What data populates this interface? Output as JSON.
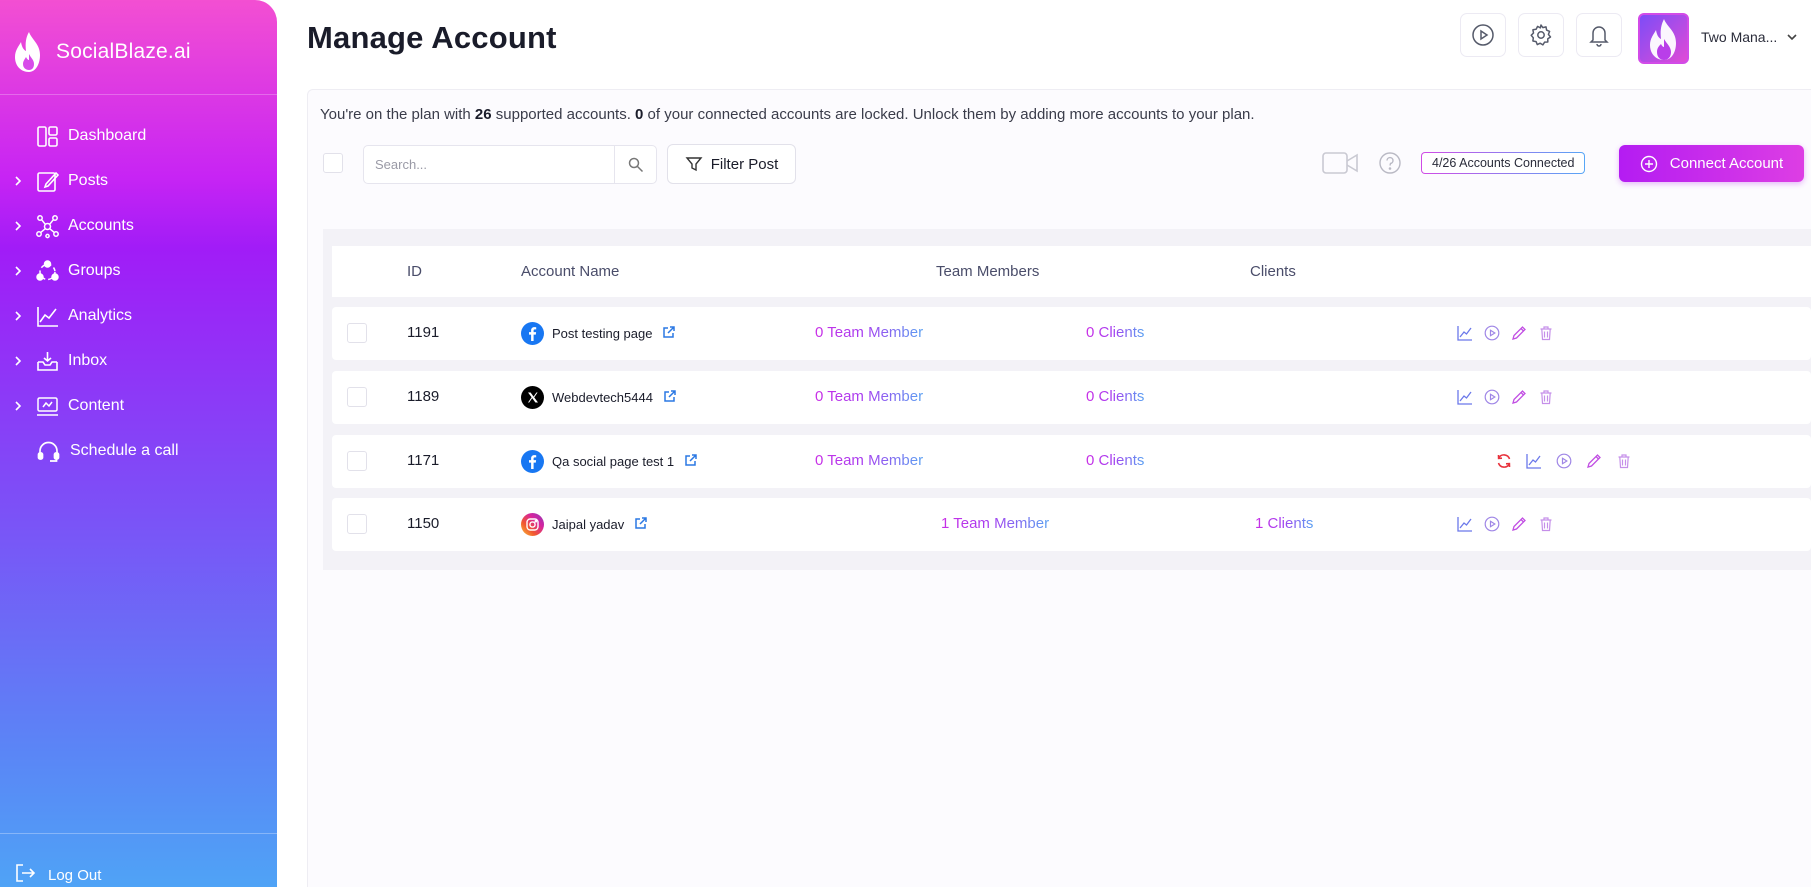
{
  "brand": {
    "name": "SocialBlaze.ai"
  },
  "sidebar": {
    "items": [
      {
        "label": "Dashboard",
        "icon": "dashboard-icon"
      },
      {
        "label": "Posts",
        "icon": "edit-icon"
      },
      {
        "label": "Accounts",
        "icon": "network-icon"
      },
      {
        "label": "Groups",
        "icon": "groups-icon"
      },
      {
        "label": "Analytics",
        "icon": "analytics-icon"
      },
      {
        "label": "Inbox",
        "icon": "inbox-icon"
      },
      {
        "label": "Content",
        "icon": "content-icon"
      },
      {
        "label": "Schedule a call",
        "icon": "headset-icon"
      }
    ],
    "logout": "Log Out"
  },
  "header": {
    "title": "Manage Account",
    "user_name": "Two Mana..."
  },
  "notice": {
    "prefix": "You're on the plan with ",
    "supported": "26",
    "middle": " supported accounts. ",
    "locked": "0",
    "suffix": " of your connected accounts are locked. Unlock them by adding more accounts to your plan."
  },
  "toolbar": {
    "search_placeholder": "Search...",
    "filter_label": "Filter Post",
    "accounts_connected": "4/26 Accounts Connected",
    "connect_label": "Connect Account"
  },
  "table": {
    "headers": {
      "id": "ID",
      "account_name": "Account Name",
      "team_members": "Team Members",
      "clients": "Clients"
    },
    "rows": [
      {
        "id": "1191",
        "name": "Post testing page",
        "platform": "facebook",
        "team": "0 Team Member",
        "clients": "0 Clients",
        "refresh": false
      },
      {
        "id": "1189",
        "name": "Webdevtech5444",
        "platform": "x",
        "team": "0 Team Member",
        "clients": "0 Clients",
        "refresh": false
      },
      {
        "id": "1171",
        "name": "Qa social page test 1",
        "platform": "facebook",
        "team": "0 Team Member",
        "clients": "0 Clients",
        "refresh": true
      },
      {
        "id": "1150",
        "name": "Jaipal yadav",
        "platform": "instagram",
        "team": "1 Team Member",
        "clients": "1 Clients",
        "refresh": false
      }
    ]
  },
  "colors": {
    "accent": "#b41cf2",
    "sidebar_top": "#f34fd2",
    "sidebar_bottom": "#4fa3f6",
    "refresh": "#e8323c",
    "facebook": "#1877f2",
    "x": "#000000"
  }
}
